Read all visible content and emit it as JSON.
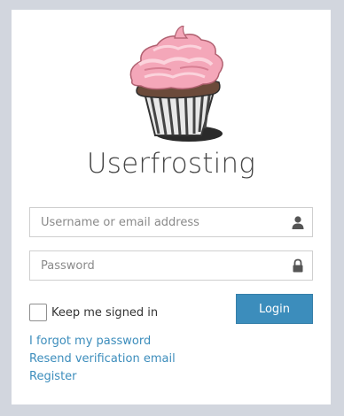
{
  "logo": {
    "title": "Userfrosting",
    "image_icon": "cupcake-icon"
  },
  "form": {
    "username_placeholder": "Username or email address",
    "username_value": "",
    "username_icon": "user-icon",
    "password_placeholder": "Password",
    "password_value": "",
    "password_icon": "lock-icon",
    "remember_label": "Keep me signed in",
    "remember_checked": false,
    "login_label": "Login"
  },
  "links": {
    "forgot_password": "I forgot my password",
    "resend_verification": "Resend verification email",
    "register": "Register"
  },
  "colors": {
    "page_background": "#d2d6de",
    "primary": "#3c8dbc",
    "frosting": "#f4a7b9"
  }
}
